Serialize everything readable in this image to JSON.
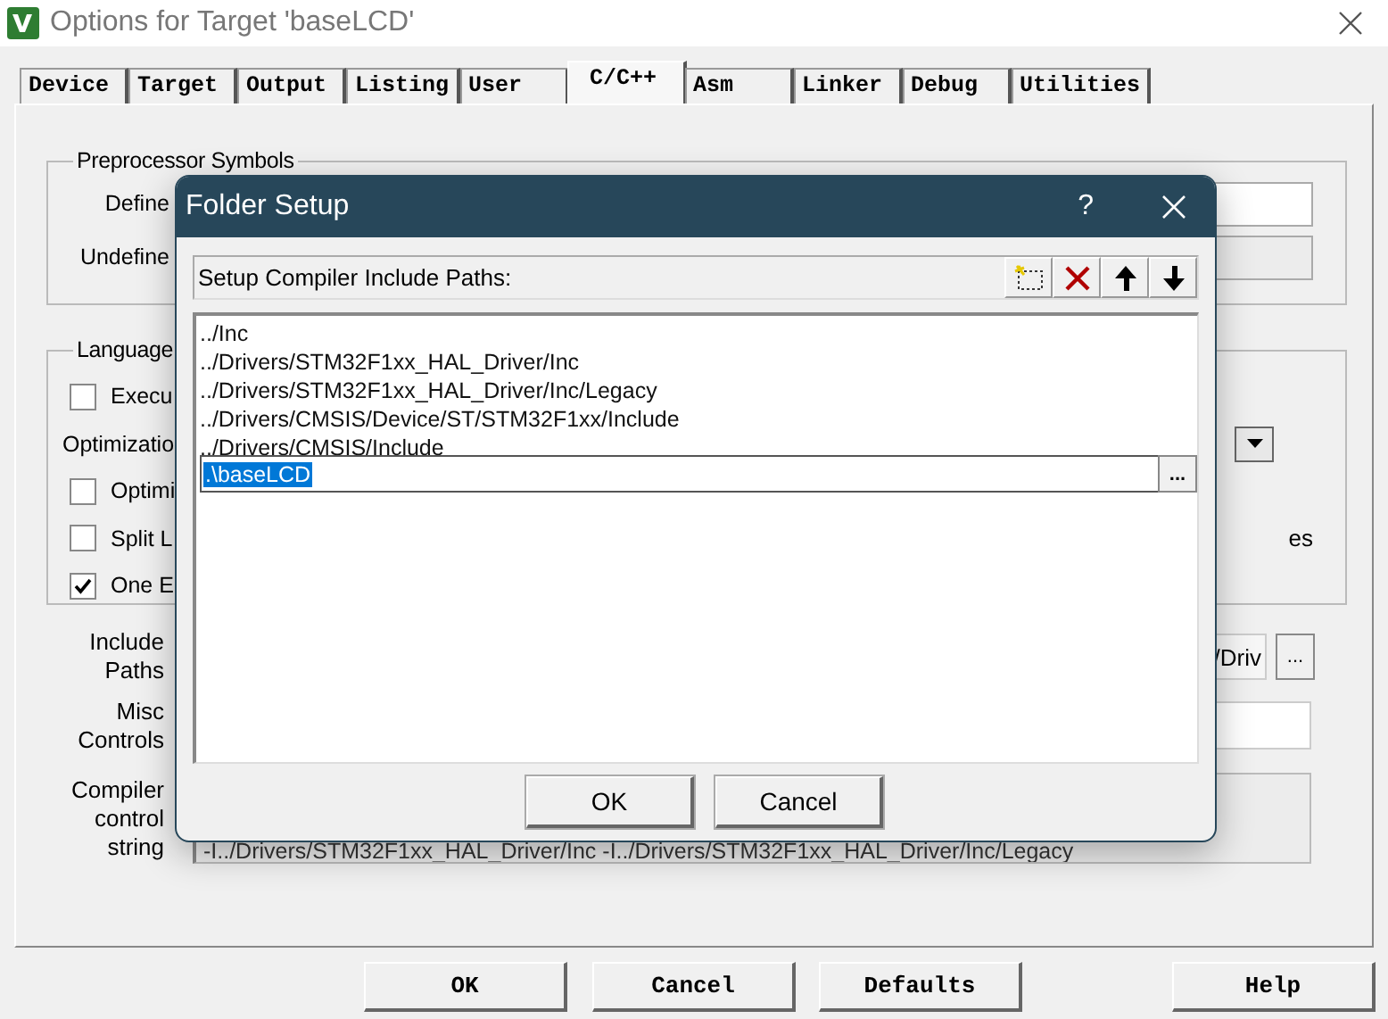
{
  "window": {
    "title": "Options for Target 'baseLCD'"
  },
  "tabs": [
    {
      "label": "Device",
      "selected": false
    },
    {
      "label": "Target",
      "selected": false
    },
    {
      "label": "Output",
      "selected": false
    },
    {
      "label": "Listing",
      "selected": false
    },
    {
      "label": "User",
      "selected": false
    },
    {
      "label": "C/C++",
      "selected": true
    },
    {
      "label": "Asm",
      "selected": false
    },
    {
      "label": "Linker",
      "selected": false
    },
    {
      "label": "Debug",
      "selected": false
    },
    {
      "label": "Utilities",
      "selected": false
    }
  ],
  "preprocessor": {
    "title": "Preprocessor Symbols",
    "rows": [
      {
        "label": "Define",
        "disabled": false
      },
      {
        "label": "Undefine",
        "disabled": true
      }
    ]
  },
  "language": {
    "title": "Language",
    "rows": [
      {
        "kind": "checkbox",
        "label": "Execu",
        "checked": false
      },
      {
        "kind": "dropdown",
        "label": "Optimizatio"
      },
      {
        "kind": "checkbox",
        "label": "Optimi",
        "checked": false
      },
      {
        "kind": "checkbox",
        "label": "Split L",
        "checked": false,
        "right_text": "es"
      },
      {
        "kind": "checkbox",
        "label": "One E",
        "checked": true
      }
    ]
  },
  "include_paths": {
    "label": "Include Paths",
    "value": "/Driv",
    "browse": "..."
  },
  "misc_controls": {
    "label": "Misc Controls"
  },
  "compiler_string": {
    "label": "Compiler control string",
    "value": "-I../Drivers/STM32F1xx_HAL_Driver/Inc -I../Drivers/STM32F1xx_HAL_Driver/Inc/Legacy"
  },
  "buttons": [
    "OK",
    "Cancel",
    "Defaults",
    "Help"
  ],
  "dialog": {
    "title": "Folder Setup",
    "help": "?",
    "header": "Setup Compiler Include Paths:",
    "paths": [
      "../Inc",
      "../Drivers/STM32F1xx_HAL_Driver/Inc",
      "../Drivers/STM32F1xx_HAL_Driver/Inc/Legacy",
      "../Drivers/CMSIS/Device/ST/STM32F1xx/Include",
      "../Drivers/CMSIS/Include"
    ],
    "editing": {
      "value": ".\\baseLCD",
      "selected": true
    },
    "browse": "...",
    "buttons": [
      "OK",
      "Cancel"
    ]
  }
}
